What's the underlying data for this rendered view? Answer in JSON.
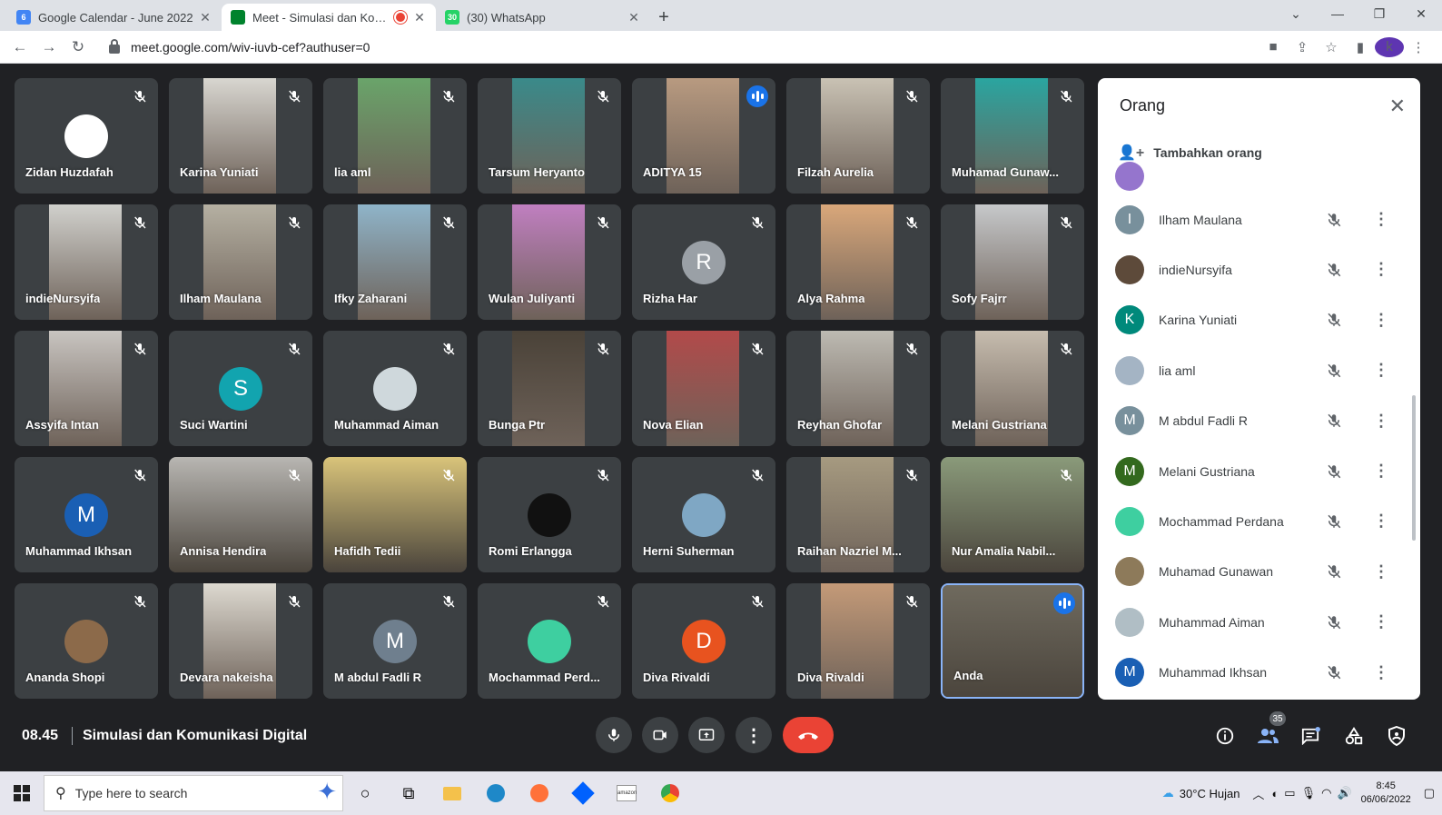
{
  "browser": {
    "tabs": [
      {
        "title": "Google Calendar - June 2022",
        "favicon": "calendar-icon",
        "color": "#4285f4",
        "fav_text": "6"
      },
      {
        "title": "Meet - Simulasi dan Komunik",
        "favicon": "meet-icon",
        "color": "#00832d",
        "fav_text": ""
      },
      {
        "title": "(30) WhatsApp",
        "favicon": "whatsapp-icon",
        "color": "#25d366",
        "fav_text": "30"
      }
    ],
    "url": "meet.google.com/wiv-iuvb-cef?authuser=0",
    "profile_initial": "k"
  },
  "tiles": [
    {
      "name": "Zidan Huzdafah",
      "kind": "avatar",
      "initial": "",
      "color": "#ffffff"
    },
    {
      "name": "Karina Yuniati",
      "kind": "video",
      "color": "#d8d6d0"
    },
    {
      "name": "lia aml",
      "kind": "video",
      "color": "#6aa46a"
    },
    {
      "name": "Tarsum Heryanto",
      "kind": "video",
      "color": "#3a8a8a"
    },
    {
      "name": "ADITYA 15",
      "kind": "video",
      "color": "#b89a80",
      "speaking": true
    },
    {
      "name": "Filzah Aurelia",
      "kind": "video",
      "color": "#c9c2b4"
    },
    {
      "name": "Muhamad Gunaw...",
      "kind": "video",
      "color": "#2aa5a0"
    },
    {
      "name": "indieNursyifa",
      "kind": "video",
      "color": "#d0d0cc"
    },
    {
      "name": "Ilham Maulana",
      "kind": "video",
      "color": "#b5b0a2"
    },
    {
      "name": "Ifky Zaharani",
      "kind": "video",
      "color": "#8fb4c9"
    },
    {
      "name": "Wulan Juliyanti",
      "kind": "video",
      "color": "#c07fc0"
    },
    {
      "name": "Rizha Har",
      "kind": "avatar",
      "initial": "R",
      "color": "#9aa0a6"
    },
    {
      "name": "Alya Rahma",
      "kind": "video",
      "color": "#d9a77a"
    },
    {
      "name": "Sofy Fajrr",
      "kind": "video",
      "color": "#c6c8ca"
    },
    {
      "name": "Assyifa Intan",
      "kind": "video",
      "color": "#c8c4c0"
    },
    {
      "name": "Suci Wartini",
      "kind": "avatar",
      "initial": "S",
      "color": "#12a4af"
    },
    {
      "name": "Muhammad Aiman",
      "kind": "avatar",
      "initial": "",
      "color": "#cfd8dc"
    },
    {
      "name": "Bunga Ptr",
      "kind": "video",
      "color": "#4a4238"
    },
    {
      "name": "Nova Elian",
      "kind": "video",
      "color": "#b24a4a"
    },
    {
      "name": "Reyhan Ghofar",
      "kind": "video",
      "color": "#bdbab2"
    },
    {
      "name": "Melani Gustriana",
      "kind": "video",
      "color": "#c6bcae"
    },
    {
      "name": "Muhammad Ikhsan",
      "kind": "avatar",
      "initial": "M",
      "color": "#1a5fb4"
    },
    {
      "name": "Annisa Hendira",
      "kind": "videofull",
      "color": "#b8b6b2"
    },
    {
      "name": "Hafidh Tedii",
      "kind": "videofull",
      "color": "#d9c47a"
    },
    {
      "name": "Romi Erlangga",
      "kind": "avatar",
      "initial": "",
      "color": "#111111"
    },
    {
      "name": "Herni Suherman",
      "kind": "avatar",
      "initial": "",
      "color": "#7fa7c4"
    },
    {
      "name": "Raihan Nazriel M...",
      "kind": "video",
      "color": "#a69a80"
    },
    {
      "name": "Nur Amalia Nabil...",
      "kind": "videofull",
      "color": "#8a9a7a"
    },
    {
      "name": "Ananda Shopi",
      "kind": "avatar",
      "initial": "",
      "color": "#8c6a4a"
    },
    {
      "name": "Devara nakeisha",
      "kind": "video",
      "color": "#ddd9d0"
    },
    {
      "name": "M abdul Fadli R",
      "kind": "avatar",
      "initial": "M",
      "color": "#6f7f8e"
    },
    {
      "name": "Mochammad Perd...",
      "kind": "avatar",
      "initial": "",
      "color": "#3ecfa0"
    },
    {
      "name": "Diva Rivaldi",
      "kind": "avatar",
      "initial": "D",
      "color": "#e8531f"
    },
    {
      "name": "Diva Rivaldi",
      "kind": "video",
      "color": "#c49a78"
    },
    {
      "name": "Anda",
      "kind": "self",
      "color": "#6f6a5e",
      "speaking": true
    }
  ],
  "panel": {
    "title": "Orang",
    "add_label": "Tambahkan orang",
    "people": [
      {
        "name": "Ilham Maulana",
        "initial": "I",
        "color": "#78909c"
      },
      {
        "name": "indieNursyifa",
        "initial": "",
        "color": "#5d4a3a"
      },
      {
        "name": "Karina Yuniati",
        "initial": "K",
        "color": "#00897b"
      },
      {
        "name": "lia aml",
        "initial": "",
        "color": "#a4b4c4"
      },
      {
        "name": "M abdul Fadli R",
        "initial": "M",
        "color": "#78909c"
      },
      {
        "name": "Melani Gustriana",
        "initial": "M",
        "color": "#33691e"
      },
      {
        "name": "Mochammad Perdana",
        "initial": "",
        "color": "#3ecfa0"
      },
      {
        "name": "Muhamad Gunawan",
        "initial": "",
        "color": "#8d7a5a"
      },
      {
        "name": "Muhammad Aiman",
        "initial": "",
        "color": "#b0bec5"
      },
      {
        "name": "Muhammad Ikhsan",
        "initial": "M",
        "color": "#1a5fb4"
      }
    ]
  },
  "meeting": {
    "time": "08.45",
    "title": "Simulasi dan Komunikasi Digital",
    "participant_count": "35"
  },
  "taskbar": {
    "search_placeholder": "Type here to search",
    "weather": "30°C  Hujan",
    "time": "8:45",
    "date": "06/06/2022"
  }
}
